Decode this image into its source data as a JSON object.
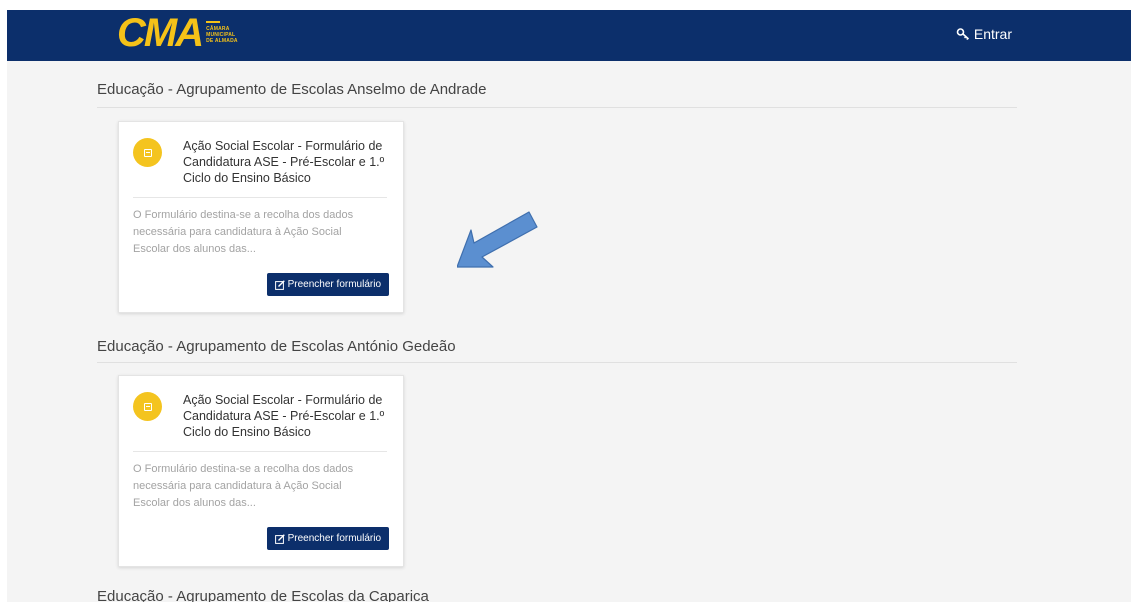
{
  "header": {
    "logo_text": "CMA",
    "logo_sub": [
      "CÂMARA",
      "MUNICIPAL",
      "DE ALMADA"
    ],
    "login_label": "Entrar",
    "bg_color": "#0c2f6b",
    "accent_color": "#f5c218"
  },
  "sections": [
    {
      "title": "Educação - Agrupamento de Escolas Anselmo de Andrade",
      "card": {
        "title": "Ação Social Escolar - Formulário de Candidatura ASE - Pré-Escolar e 1.º Ciclo do Ensino Básico",
        "description": "O Formulário destina-se a recolha dos dados necessária para candidatura à Ação Social Escolar dos alunos das...",
        "button_label": "Preencher formulário"
      }
    },
    {
      "title": "Educação - Agrupamento de Escolas António Gedeão",
      "card": {
        "title": "Ação Social Escolar - Formulário de Candidatura ASE - Pré-Escolar e 1.º Ciclo do Ensino Básico",
        "description": "O Formulário destina-se a recolha dos dados necessária para candidatura à Ação Social Escolar dos alunos das...",
        "button_label": "Preencher formulário"
      }
    },
    {
      "title": "Educação - Agrupamento de Escolas da Caparica"
    }
  ],
  "annotation": {
    "icon": "arrow-annotation-icon",
    "color": "#5b8fd0"
  }
}
